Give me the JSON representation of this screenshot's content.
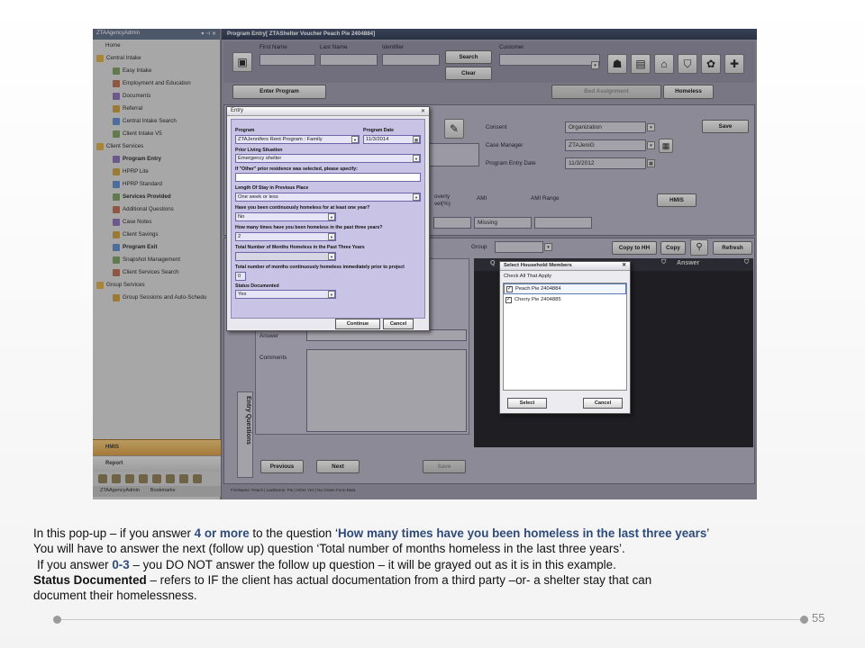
{
  "tree": {
    "title": "ZTAAgencyAdmin",
    "title_controls": "▾ ⊣ ✕",
    "items": [
      {
        "label": "Home",
        "level": 1,
        "bold": false
      },
      {
        "label": "Central Intake",
        "level": 0,
        "bold": false
      },
      {
        "label": "Easy Intake",
        "level": 2,
        "bold": false
      },
      {
        "label": "Employment and Education",
        "level": 2,
        "bold": false
      },
      {
        "label": "Documents",
        "level": 2,
        "bold": false
      },
      {
        "label": "Referral",
        "level": 2,
        "bold": false
      },
      {
        "label": "Central Intake Search",
        "level": 2,
        "bold": false
      },
      {
        "label": "Client Intake V5",
        "level": 2,
        "bold": false
      },
      {
        "label": "Client Services",
        "level": 0,
        "bold": false
      },
      {
        "label": "Program Entry",
        "level": 2,
        "bold": true
      },
      {
        "label": "HPRP Lite",
        "level": 2,
        "bold": false
      },
      {
        "label": "HPRP Standard",
        "level": 2,
        "bold": false
      },
      {
        "label": "Services Provided",
        "level": 2,
        "bold": true
      },
      {
        "label": "Additional Questions",
        "level": 2,
        "bold": false
      },
      {
        "label": "Case Notes",
        "level": 2,
        "bold": false
      },
      {
        "label": "Client Savings",
        "level": 2,
        "bold": false
      },
      {
        "label": "Program Exit",
        "level": 2,
        "bold": true
      },
      {
        "label": "Snapshot Management",
        "level": 2,
        "bold": false
      },
      {
        "label": "Client Services Search",
        "level": 2,
        "bold": false
      },
      {
        "label": "Group Services",
        "level": 0,
        "bold": false
      },
      {
        "label": "Group Sessions and Auto-Schedu",
        "level": 2,
        "bold": false
      }
    ],
    "bottom": {
      "hmis": "HMIS",
      "report": "Report",
      "tab1": "ZTAAgencyAdmin",
      "tab2": "Bookmarks"
    }
  },
  "main": {
    "title": "Program Entry[ ZTAShelter Voucher Peach Pie 2404884]",
    "search": {
      "first_name": "First Name",
      "last_name": "Last Name",
      "identifier": "Identifier",
      "customer": "Customer",
      "search_btn": "Search",
      "clear_btn": "Clear"
    },
    "tabs": {
      "enter_program": "Enter Program",
      "bed_assignment": "Bed Assignment",
      "homeless": "Homeless"
    },
    "info": {
      "consent_label": "Consent",
      "consent_value": "Organization",
      "case_manager_label": "Case Manager",
      "case_manager_value": "ZTAJeniG",
      "entry_date_label": "Program Entry Date",
      "entry_date_value": "11/3/2012",
      "save_btn": "Save",
      "poverty_label": "overty\nvel(%)",
      "ami_label": "AMI",
      "ami_range_label": "AMI Range",
      "ami_value": "Missing",
      "hmis_btn": "HMIS"
    },
    "lower": {
      "group_label": "Group",
      "copy_hh": "Copy to HH",
      "copy": "Copy",
      "refresh": "Refresh",
      "answer_header": "Answer",
      "q_header": "Q",
      "answer_label": "Answer",
      "comments_label": "Comments",
      "entry_questions_tab": "Entry Questions",
      "previous": "Previous",
      "next": "Next",
      "save": "Save",
      "status": "FirstName: Peach | LastName: Pie | HOH: Yes | No Green Form Data"
    }
  },
  "entry_dialog": {
    "title": "Entry",
    "close": "✕",
    "program_label": "Program",
    "program_date_label": "Program Date",
    "program_value": "ZTAJennifers Rent Program : Family",
    "program_date_value": "11/3/2014",
    "prior_living_label": "Prior Living Situation",
    "prior_living_value": "Emergency shelter",
    "other_label": "If \"Other\" prior residence was selected, please specify:",
    "other_value": "",
    "length_label": "Length Of Stay in Previous Place",
    "length_value": "One week or less",
    "continuous_label": "Have you been continuously homeless for at least one year?",
    "continuous_value": "No",
    "times_label": "How many times have you been homeless in the past three years?",
    "times_value": "2",
    "months_label": "Total Number of Months Homeless in the Past Three Years",
    "months_value": "",
    "months_cont_label": "Total number of months continuously homeless immediately prior to project",
    "months_cont_value": "0",
    "status_label": "Status Documented",
    "status_value": "Yes",
    "continue_btn": "Continue",
    "cancel_btn": "Cancel"
  },
  "household_dialog": {
    "title": "Select Household Members",
    "close": "✕",
    "check_all": "Check All That Apply",
    "members": [
      "Peach Pie 2404884",
      "Cherry Pie 2404885"
    ],
    "select_btn": "Select",
    "cancel_btn": "Cancel"
  },
  "caption": {
    "l1_a": "In this pop-up – if you answer ",
    "l1_b": "4 or more",
    "l1_c": " to the question ‘",
    "l1_d": "How many times have you been homeless in the last three years",
    "l1_e": "’",
    "l2": "You will have to answer the next (follow up) question ‘Total number of months homeless in the last three years’.",
    "l3_a": "If you answer ",
    "l3_b": "0-3",
    "l3_c": " – you DO NOT answer the follow up question – it will be grayed out as it is in this example.",
    "l4_a": "Status Documented",
    "l4_b": " – refers to IF the client has actual documentation from a third party –or- a shelter stay that can",
    "l5": "document their homelessness."
  },
  "page_number": "55",
  "colors": {
    "accent_blue": "#2e4b7a",
    "tree_bg": "#d9d9d9",
    "dialog_bg": "#c9c4e6"
  }
}
